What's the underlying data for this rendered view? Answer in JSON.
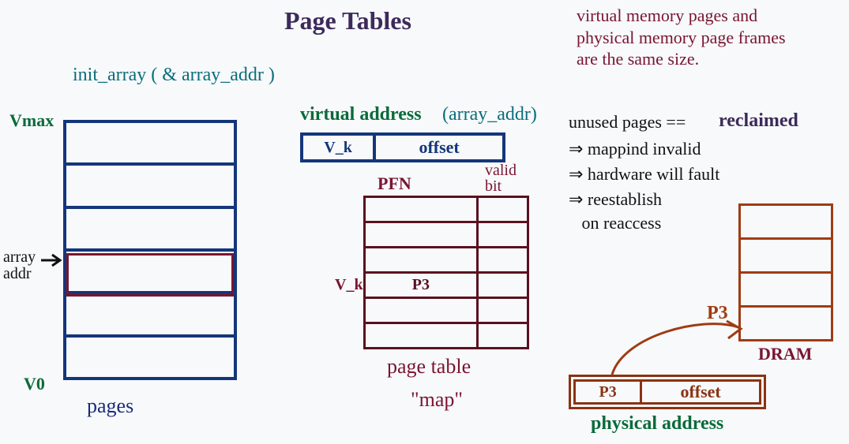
{
  "title": "Page Tables",
  "init_call": "init_array ( & array_addr )",
  "vmem": {
    "top_label": "Vmax",
    "bottom_label": "V0",
    "pointer_label": "array\naddr",
    "caption": "pages"
  },
  "vaddr": {
    "heading": "virtual address",
    "heading_paren": "(array_addr)",
    "vpn": "V_k",
    "offset": "offset"
  },
  "ptable": {
    "col1": "PFN",
    "col2": "valid\nbit",
    "row_label": "V_k",
    "cell_value": "P3",
    "caption1": "page table",
    "caption2": "\"map\""
  },
  "paddr": {
    "pfn": "P3",
    "offset": "offset",
    "caption": "physical address",
    "arrow_label": "P3"
  },
  "dram_label": "DRAM",
  "note_top": "virtual memory pages and\nphysical memory page frames\nare the same size.",
  "notes": {
    "l1a": "unused pages ==",
    "l1b": "reclaimed",
    "l2": "⇒ mappind invalid",
    "l3": "⇒ hardware will fault",
    "l4": "⇒ reestablish",
    "l5": "   on reaccess"
  }
}
